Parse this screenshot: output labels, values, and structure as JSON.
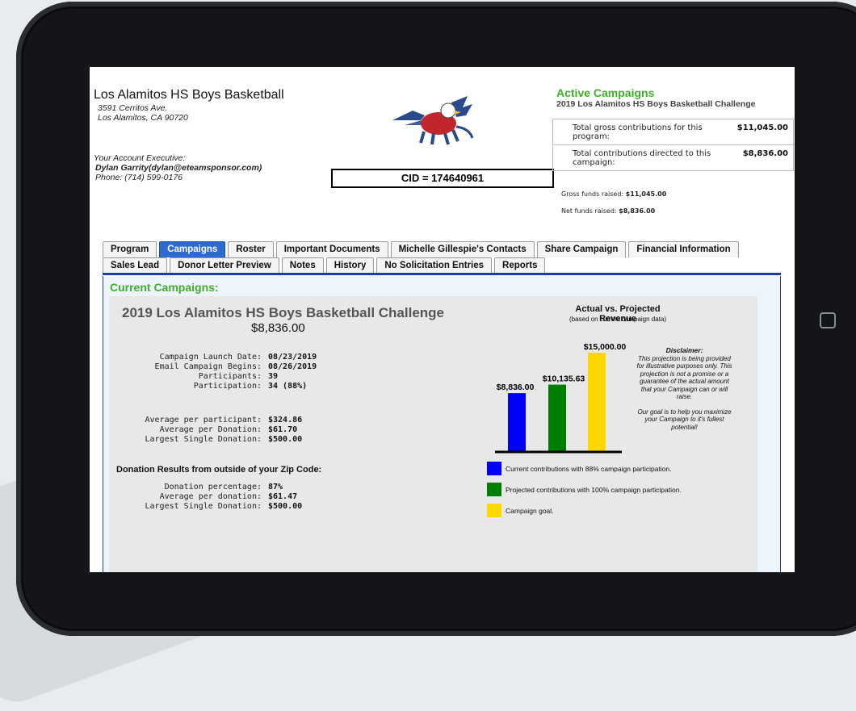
{
  "org": {
    "name": "Los Alamitos HS Boys Basketball",
    "address1": "3591 Cerritos Ave.",
    "address2": "Los Alamitos, CA 90720"
  },
  "account": {
    "label": "Your Account Executive:",
    "name": "Dylan Garrity(dylan@eteamsponsor.com)",
    "phone": "Phone: (714) 599-0176"
  },
  "cid": "CID = 174640961",
  "active": {
    "title": "Active Campaigns",
    "campaign": "2019 Los Alamitos HS Boys Basketball Challenge",
    "rows": [
      {
        "label": "Total gross contributions for this program:",
        "value": "$11,045.00"
      },
      {
        "label": "Total contributions directed to this campaign:",
        "value": "$8,836.00"
      }
    ],
    "gross_label": "Gross funds raised:",
    "gross_value": "$11,045.00",
    "net_label": "Net funds raised:",
    "net_value": "$8,836.00"
  },
  "tabs": {
    "row1": [
      "Program",
      "Campaigns",
      "Roster",
      "Important Documents",
      "Michelle Gillespie's Contacts",
      "Share Campaign",
      "Financial Information"
    ],
    "row2": [
      "Sales Lead",
      "Donor Letter Preview",
      "Notes",
      "History",
      "No Solicitation Entries",
      "Reports"
    ],
    "active": "Campaigns"
  },
  "current": {
    "title": "Current Campaigns:",
    "campaign_title": "2019 Los Alamitos HS Boys Basketball Challenge",
    "amount": "$8,836.00",
    "stats1": [
      {
        "k": "Campaign Launch Date:",
        "v": "08/23/2019"
      },
      {
        "k": "Email Campaign Begins:",
        "v": "08/26/2019"
      },
      {
        "k": "Participants:",
        "v": "39"
      },
      {
        "k": "Participation:",
        "v": "34 (88%)"
      }
    ],
    "stats2": [
      {
        "k": "Average per participant:",
        "v": "$324.86"
      },
      {
        "k": "Average per Donation:",
        "v": "$61.70"
      },
      {
        "k": "Largest Single Donation:",
        "v": "$500.00"
      }
    ],
    "zip_title": "Donation Results from outside of your Zip Code:",
    "stats3": [
      {
        "k": "Donation percentage:",
        "v": "87%"
      },
      {
        "k": "Average per donation:",
        "v": "$61.47"
      },
      {
        "k": "Largest Single Donation:",
        "v": "$500.00"
      }
    ]
  },
  "chart_data": {
    "type": "bar",
    "title": "Actual vs. Projected Revenue",
    "subtitle": "(based on current campaign data)",
    "categories": [
      "Current",
      "Projected",
      "Goal"
    ],
    "values": [
      8836.0,
      10135.63,
      15000.0
    ],
    "labels": [
      "$8,836.00",
      "$10,135.63",
      "$15,000.00"
    ],
    "colors": [
      "#0000ff",
      "#008000",
      "#ffd700"
    ],
    "ylim": [
      0,
      15000
    ],
    "legend": [
      "Current contributions with 88% campaign participation.",
      "Projected contributions with 100% campaign participation.",
      "Campaign goal."
    ]
  },
  "disclaimer": {
    "heading": "Disclaimer:",
    "text": "This projection is being provided for illustrative purposes only. This projection is not a promise or a guarantee of the actual amount that your Campaign can or will raise.",
    "goal": "Our goal is to help you maximize your Campaign to it's fullest potential!"
  }
}
